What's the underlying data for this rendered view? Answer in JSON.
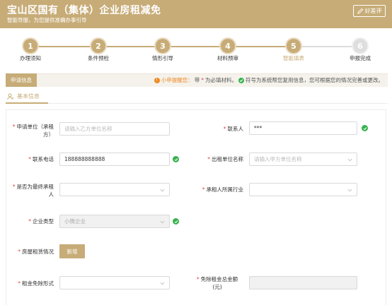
{
  "header": {
    "title": "宝山区国有（集体）企业房租减免",
    "subtitle": "智能导服，为您提供准确办事引导",
    "review_button": "好差评"
  },
  "steps": [
    {
      "num": "1",
      "label": "办理须知",
      "state": "done"
    },
    {
      "num": "2",
      "label": "条件预检",
      "state": "done"
    },
    {
      "num": "3",
      "label": "情形引导",
      "state": "done"
    },
    {
      "num": "4",
      "label": "材料预审",
      "state": "done"
    },
    {
      "num": "5",
      "label": "智能填表",
      "state": "active"
    },
    {
      "num": "6",
      "label": "申报完成",
      "state": "disabled"
    }
  ],
  "infobar": {
    "tag": "申请信息",
    "tip_title": "小申提醒您：",
    "tip_text_1": "带",
    "tip_star": "*",
    "tip_text_2": "为必填材料。",
    "tip_text_3": "符号为系统帮您复用信息，您可根据您的情况完善或更改。"
  },
  "section": {
    "title": "基本信息"
  },
  "form": {
    "applicant_label_1": "申请单位（承租",
    "applicant_label_2": "方）",
    "applicant_placeholder": "请输入乙方单位名称",
    "contact_label": "联系人",
    "contact_value": "***",
    "phone_label": "联系电话",
    "phone_value": "188888888888",
    "lessor_label": "出租单位名称",
    "lessor_placeholder": "请输入甲方单位名称",
    "final_tenant_label_1": "是否为最终承租",
    "final_tenant_label_2": "人",
    "industry_label": "承租人所属行业",
    "company_type_label": "企业类型",
    "company_type_value": "小微企业",
    "rental_label": "房屋租赁情况",
    "add_button": "新增",
    "exemption_form_label": "租金免除形式",
    "total_label_1": "免除租金总金额",
    "total_label_2": "(元)"
  },
  "colors": {
    "brand": "#c7ac78",
    "required": "#e04848",
    "success": "#37b24d",
    "warning": "#f08a24"
  }
}
